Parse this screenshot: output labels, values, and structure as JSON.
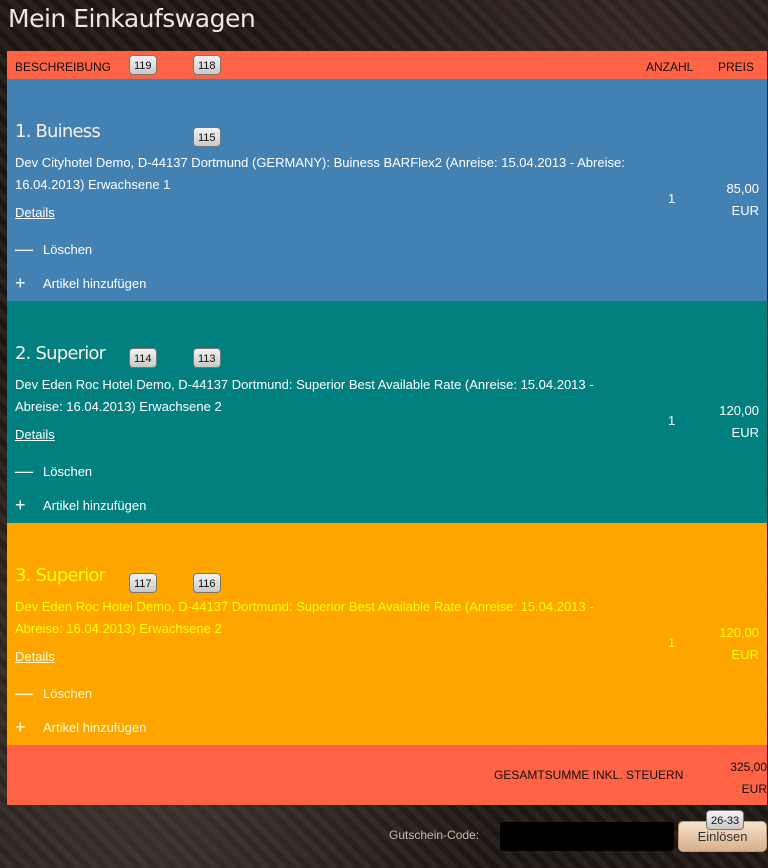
{
  "page": {
    "title": "Mein Einkaufswagen"
  },
  "cart": {
    "headers": {
      "description": "BESCHREIBUNG",
      "quantity": "ANZAHL",
      "price": "PREIS"
    },
    "header_badges": [
      "119",
      "118"
    ],
    "items": [
      {
        "title": "1. Buiness",
        "description": "Dev Cityhotel Demo, D-44137 Dortmund (GERMANY): Buiness BARFlex2 (Anreise: 15.04.2013 - Abreise: 16.04.2013) Erwachsene 1",
        "details_label": "Details",
        "delete_label": "Löschen",
        "add_label": "Artikel hinzufügen",
        "quantity": "1",
        "price_amount": "85,00",
        "price_currency": "EUR",
        "badges": [
          "115"
        ]
      },
      {
        "title": "2. Superior",
        "description": "Dev Eden Roc Hotel Demo, D-44137 Dortmund: Superior Best Available Rate (Anreise: 15.04.2013 - Abreise: 16.04.2013) Erwachsene 2",
        "details_label": "Details",
        "delete_label": "Löschen",
        "add_label": "Artikel hinzufügen",
        "quantity": "1",
        "price_amount": "120,00",
        "price_currency": "EUR",
        "badges": [
          "114",
          "113"
        ]
      },
      {
        "title": "3. Superior",
        "description": "Dev Eden Roc Hotel Demo, D-44137 Dortmund: Superior Best Available Rate (Anreise: 15.04.2013 - Abreise: 16.04.2013) Erwachsene 2",
        "details_label": "Details",
        "delete_label": "Löschen",
        "add_label": "Artikel hinzufügen",
        "quantity": "1",
        "price_amount": "120,00",
        "price_currency": "EUR",
        "badges": [
          "117",
          "116"
        ]
      }
    ],
    "total": {
      "label": "GESAMTSUMME INKL. STEUERN",
      "amount": "325,00",
      "currency": "EUR"
    }
  },
  "coupon": {
    "label": "Gutschein-Code:",
    "value": "",
    "button_label": "Einlösen",
    "button_badge": "26-33"
  },
  "colors": {
    "header_bg": "#fe6346",
    "item_1_bg": "#4481b3",
    "item_2_bg": "#027f7f",
    "item_3_bg": "#ffa500",
    "item_3_text": "#ffff00"
  },
  "icons": {
    "delete": "minus-icon",
    "add": "plus-icon"
  }
}
